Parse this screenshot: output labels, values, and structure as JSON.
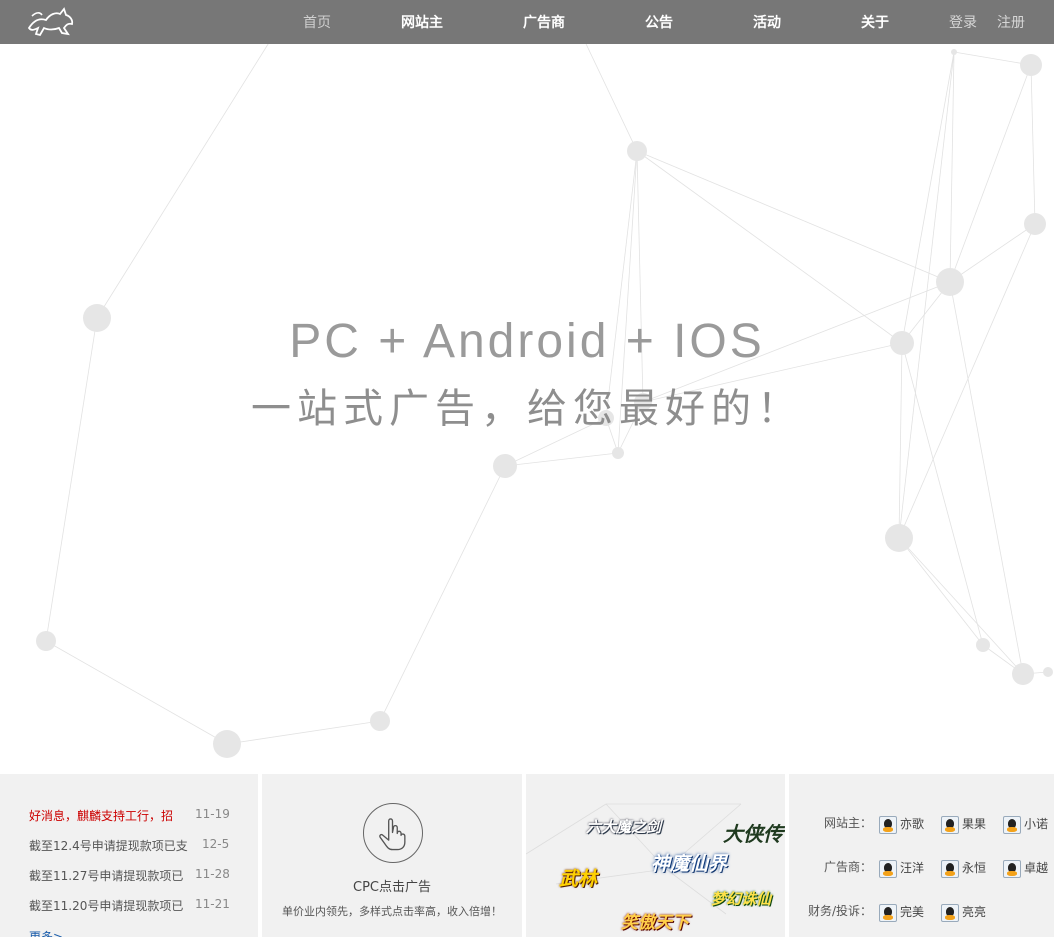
{
  "nav": {
    "items": [
      "首页",
      "网站主",
      "广告商",
      "公告",
      "活动",
      "关于"
    ],
    "login": "登录",
    "register": "注册"
  },
  "hero": {
    "line1": "PC + Android + IOS",
    "line2": "一站式广告，给您最好的！"
  },
  "news": {
    "items": [
      {
        "title": "好消息，麒麟支持工行，招",
        "date": "11-19"
      },
      {
        "title": "截至12.4号申请提现款项已支",
        "date": "12-5"
      },
      {
        "title": "截至11.27号申请提现款项已",
        "date": "11-28"
      },
      {
        "title": "截至11.20号申请提现款项已",
        "date": "11-21"
      }
    ],
    "more": "更多>"
  },
  "cpc": {
    "title": "CPC点击广告",
    "desc": "单价业内领先，多样式点击率高，收入倍增！"
  },
  "games": [
    "六大魔之剑",
    "大侠传",
    "神魔仙界",
    "武林",
    "梦幻诛仙",
    "笑傲天下"
  ],
  "contacts": [
    {
      "label": "网站主：",
      "names": [
        "亦歌",
        "果果",
        "小诺"
      ]
    },
    {
      "label": "广告商：",
      "names": [
        "汪洋",
        "永恒",
        "卓越"
      ]
    },
    {
      "label": "财务/投诉：",
      "names": [
        "完美",
        "亮亮"
      ]
    }
  ]
}
